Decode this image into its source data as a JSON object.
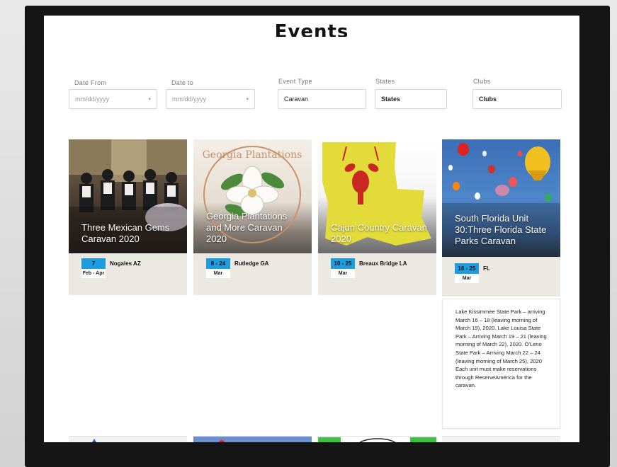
{
  "page": {
    "title": "Events"
  },
  "filters": [
    {
      "label": "Date From",
      "value": "mm/dd/yyyy",
      "has_caret": true
    },
    {
      "label": "Date to",
      "value": "mm/dd/yyyy",
      "has_caret": true
    },
    {
      "label": "Event Type",
      "value": "Caravan",
      "has_caret": false
    },
    {
      "label": "States",
      "value": "States",
      "has_caret": false
    },
    {
      "label": "Clubs",
      "value": "Clubs",
      "has_caret": false
    }
  ],
  "events": [
    {
      "title": "Three Mexican Gems Caravan 2020",
      "days": "7",
      "month": "Feb - Apr",
      "location": "Nogales AZ",
      "image": "mariachi-band-photo"
    },
    {
      "title": "Georgia Plantations and More Caravan 2020",
      "days": "8 - 24",
      "month": "Mar",
      "location": "Rutledge GA",
      "image": "georgia-magnolia-logo",
      "logo_text": "Georgia Plantations"
    },
    {
      "title": "Cajun Country Caravan 2020",
      "days": "10 - 25",
      "month": "Mar",
      "location": "Breaux Bridge LA",
      "image": "louisiana-crawfish-map"
    },
    {
      "title": "South Florida Unit 30:Three Florida State Parks Caravan",
      "days": "16 - 25",
      "month": "Mar",
      "location": "FL",
      "image": "hot-air-balloons-photo"
    }
  ],
  "description": "Lake Kissimmee State Park – arriving March 16 – 18 (leaving morning of March 19), 2020. Lake Louisa State Park – Arriving March 19 – 21 (leaving morning of March 22), 2020. O'Leno State Park – Arriving March 22 – 24 (leaving morning of March 25), 2020 Each unit must make reservations through ReserveAmerica for the caravan.",
  "colors": {
    "accent": "#1e9ce0",
    "card_bg": "#ece9e3"
  }
}
